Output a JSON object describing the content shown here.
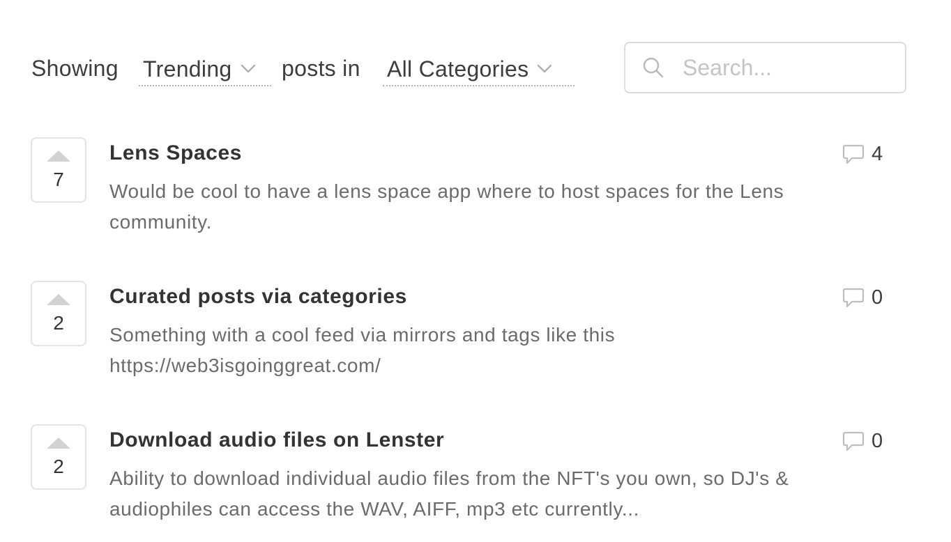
{
  "filter": {
    "showing_label": "Showing",
    "sort_value": "Trending",
    "posts_in_label": "posts in",
    "category_value": "All Categories",
    "search_placeholder": "Search...",
    "search_value": ""
  },
  "icons": {
    "sort_chevron": "chevron-down-icon",
    "category_chevron": "chevron-down-icon",
    "search": "search-icon",
    "upvote": "upvote-triangle-icon",
    "comment": "comment-bubble-icon"
  },
  "colors": {
    "text": "#333333",
    "muted_text": "#6b6b6b",
    "border": "#e3e3e3",
    "icon": "#c8c8c8",
    "placeholder": "#c4c4c4"
  },
  "posts": [
    {
      "votes": "7",
      "title": "Lens Spaces",
      "body": "Would be cool to have a lens space app where to host spaces for the Lens community.",
      "comments": "4"
    },
    {
      "votes": "2",
      "title": "Curated posts via categories",
      "body": "Something with a cool feed via mirrors and tags like this https://web3isgoinggreat.com/",
      "comments": "0"
    },
    {
      "votes": "2",
      "title": "Download audio files on Lenster",
      "body": "Ability to download individual audio files from the NFT's you own, so DJ's & audiophiles can access the WAV, AIFF, mp3 etc currently...",
      "comments": "0"
    }
  ]
}
